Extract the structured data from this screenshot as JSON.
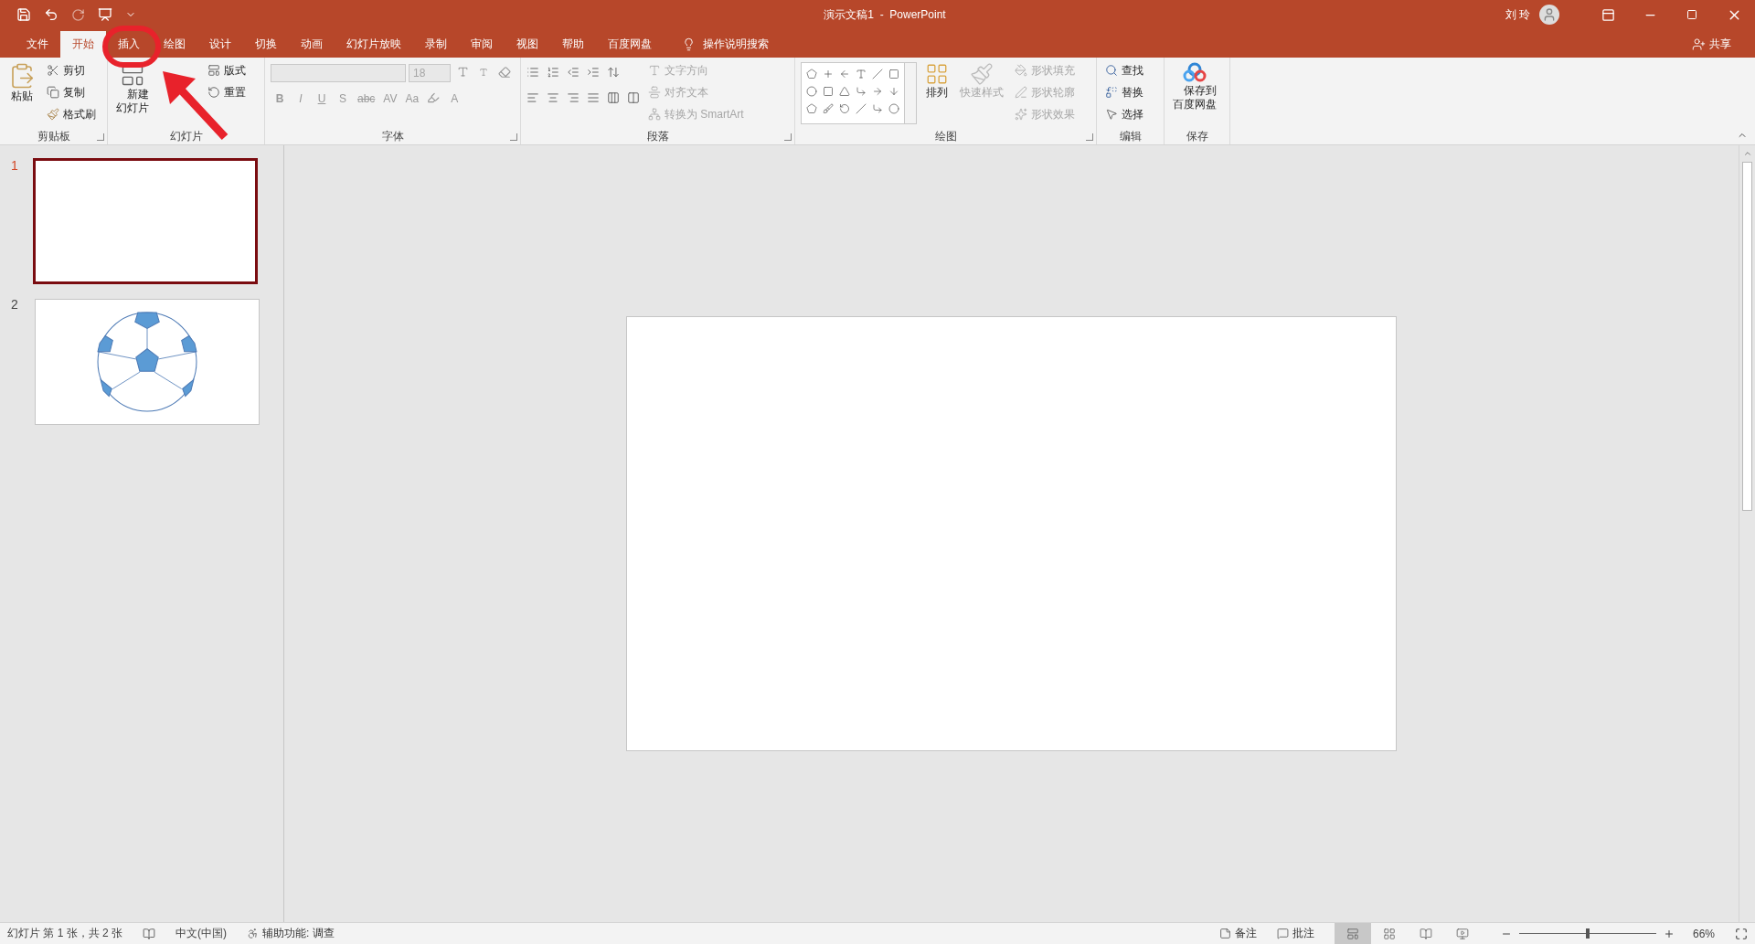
{
  "title_bar": {
    "title": "演示文稿1  -  PowerPoint",
    "user": "刘 玲"
  },
  "tabs": [
    {
      "label": "文件",
      "selected": false
    },
    {
      "label": "开始",
      "selected": true
    },
    {
      "label": "插入",
      "selected": false
    },
    {
      "label": "绘图",
      "selected": false
    },
    {
      "label": "设计",
      "selected": false
    },
    {
      "label": "切换",
      "selected": false
    },
    {
      "label": "动画",
      "selected": false
    },
    {
      "label": "幻灯片放映",
      "selected": false
    },
    {
      "label": "录制",
      "selected": false
    },
    {
      "label": "审阅",
      "selected": false
    },
    {
      "label": "视图",
      "selected": false
    },
    {
      "label": "帮助",
      "selected": false
    },
    {
      "label": "百度网盘",
      "selected": false
    }
  ],
  "tell_me": "操作说明搜索",
  "share": "共享",
  "ribbon": {
    "clipboard": {
      "label": "剪贴板",
      "paste": "粘贴",
      "cut": "剪切",
      "copy": "复制",
      "format_painter": "格式刷"
    },
    "slides": {
      "label": "幻灯片",
      "new_slide": "新建幻灯片",
      "layout": "版式",
      "reset": "重置"
    },
    "font": {
      "label": "字体",
      "disabled": true,
      "font_size": {
        "placeholder": "18"
      },
      "buttons": [
        {
          "label": "B"
        },
        {
          "label": "I"
        },
        {
          "label": "U"
        },
        {
          "label": "S"
        },
        {
          "label": "abc"
        },
        {
          "label": "AV"
        },
        {
          "label": "Aa"
        }
      ],
      "color_label": "A"
    },
    "paragraph": {
      "label": "段落",
      "commands": [
        {
          "label": "文字方向",
          "disabled": true
        },
        {
          "label": "对齐文本",
          "disabled": true
        },
        {
          "label": "转换为 SmartArt",
          "disabled": true
        }
      ]
    },
    "drawing": {
      "label": "绘图",
      "arrange": "排列",
      "quick_styles": {
        "label": "快速样式",
        "disabled": true
      },
      "commands": [
        {
          "label": "形状填充",
          "disabled": true
        },
        {
          "label": "形状轮廓",
          "disabled": true
        },
        {
          "label": "形状效果",
          "disabled": true
        }
      ]
    },
    "editing": {
      "label": "编辑",
      "find": "查找",
      "replace": "替换",
      "select": "选择"
    },
    "save": {
      "label": "保存",
      "save_to_cloud": "保存到百度网盘"
    }
  },
  "slides": [
    {
      "number": "1",
      "selected": true,
      "kind": "blank"
    },
    {
      "number": "2",
      "selected": false,
      "kind": "ball"
    }
  ],
  "annotations": [
    {
      "kind": "circle"
    },
    {
      "kind": "arrow"
    }
  ],
  "status_bar": {
    "slide_info": "幻灯片 第 1 张，共 2 张",
    "language": "中文(中国)",
    "accessibility": "辅助功能: 调查",
    "notes": "备注",
    "comments": "批注",
    "views": [
      {
        "selected": true
      },
      {
        "selected": false
      },
      {
        "selected": false
      },
      {
        "selected": false
      }
    ],
    "zoom": {
      "level": 0.5,
      "reading": "66%"
    }
  }
}
